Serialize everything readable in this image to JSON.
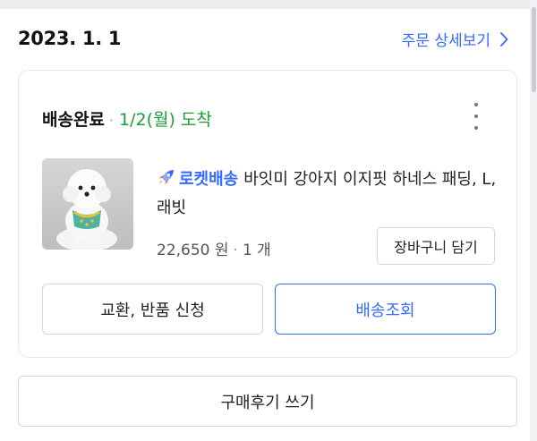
{
  "order": {
    "date": "2023. 1. 1",
    "detail_link_label": "주문 상세보기"
  },
  "shipment": {
    "status": "배송완료",
    "separator": "·",
    "arrival": "1/2(월) 도착"
  },
  "product": {
    "badge_label": "로켓배송",
    "name": "바잇미 강아지 이지핏 하네스 패딩, L, 래빗",
    "price": "22,650 원",
    "separator": "·",
    "quantity": "1 개",
    "image_alt": "white bichon dog wearing a padded harness"
  },
  "actions": {
    "add_to_cart": "장바구니 담기",
    "exchange_return": "교환, 반품 신청",
    "track_delivery": "배송조회",
    "write_review": "구매후기 쓰기"
  },
  "icons": {
    "detail": "chevron-right-icon",
    "more": "more-vertical-icon",
    "rocket": "rocket-icon"
  },
  "colors": {
    "accent": "#346aff",
    "arrival": "#1e9e3a"
  }
}
